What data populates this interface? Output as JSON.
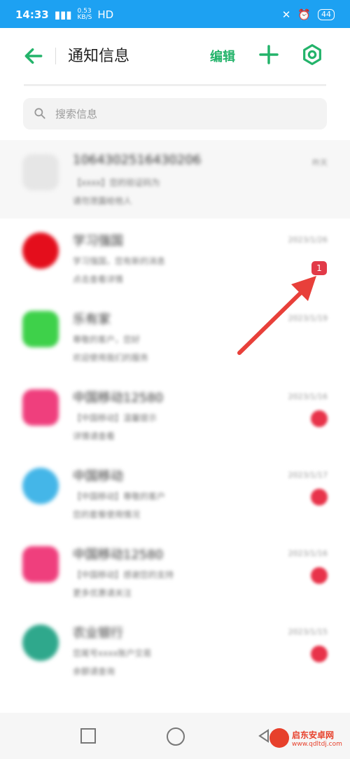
{
  "status": {
    "time": "14:33",
    "network_top": "⁴ᴳ",
    "speed": "0.53",
    "speed_unit": "KB/S",
    "hd": "HD",
    "battery": "44"
  },
  "header": {
    "title": "通知信息",
    "edit_label": "编辑"
  },
  "search": {
    "placeholder": "搜索信息"
  },
  "messages": [
    {
      "name": "1064302516430206",
      "date": "昨天",
      "line1": "【xxxx】您的验证码为",
      "line2": "请勿泄露给他人",
      "color": "#e6e6e6"
    },
    {
      "name": "学习强国",
      "date": "2023/1/26",
      "line1": "学习强国，您有新的消息",
      "line2": "点击查看详情",
      "color": "#e40e1c"
    },
    {
      "name": "乐有家",
      "date": "2023/1/19",
      "line1": "尊敬的客户，您好",
      "line2": "欢迎使用我们的服务",
      "color": "#3ed14a"
    },
    {
      "name": "中国移动12580",
      "date": "2023/1/16",
      "line1": "【中国移动】温馨提示",
      "line2": "详情请查看",
      "color": "#ef3f7d"
    },
    {
      "name": "中国移动",
      "date": "2023/1/17",
      "line1": "【中国移动】尊敬的客户",
      "line2": "您的套餐使用情况",
      "color": "#44b6e8"
    },
    {
      "name": "中国移动12580",
      "date": "2023/1/16",
      "line1": "【中国移动】感谢您的支持",
      "line2": "更多优惠请关注",
      "color": "#ef3f7d"
    },
    {
      "name": "农业银行",
      "date": "2023/1/15",
      "line1": "您尾号xxxx账户交易",
      "line2": "余额请查询",
      "color": "#2fa88c"
    }
  ],
  "badge": "1",
  "watermark": {
    "text": "启东安卓网",
    "url": "www.qdltdj.com"
  }
}
